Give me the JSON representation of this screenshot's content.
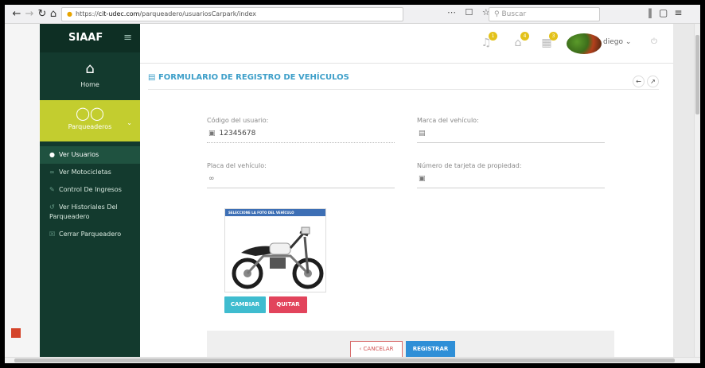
{
  "browser": {
    "url_prefix": "https://",
    "url_host": "cit-udec.com",
    "url_path": "/parqueadero/usuariosCarpark/index",
    "search_placeholder": "Buscar"
  },
  "sidebar": {
    "brand": "SIAAF",
    "home_label": "Home",
    "module_label": "Parqueaderos",
    "items": [
      {
        "label": "Ver Usuarios",
        "icon": "user-icon",
        "active": true
      },
      {
        "label": "Ver Motocicletas",
        "icon": "motorcycle-icon",
        "active": false
      },
      {
        "label": "Control De Ingresos",
        "icon": "edit-icon",
        "active": false
      },
      {
        "label": "Ver Historiales Del Parqueadero",
        "icon": "history-icon",
        "active": false
      },
      {
        "label": "Cerrar Parqueadero",
        "icon": "close-square-icon",
        "active": false
      }
    ]
  },
  "topbar": {
    "user_name": "diego",
    "notifications": [
      "1",
      "4",
      "3"
    ]
  },
  "form": {
    "title": "FORMULARIO DE REGISTRO DE VEHÍCULOS",
    "user_code_label": "Código del usuario:",
    "user_code_value": "12345678",
    "brand_label": "Marca del vehículo:",
    "brand_value": "",
    "plate_label": "Placa del vehículo:",
    "plate_value": "",
    "card_label": "Número de tarjeta de propiedad:",
    "card_value": "",
    "photo_header": "SELECCIONE LA FOTO DEL VEHÍCULO",
    "change_button": "CAMBIAR",
    "remove_button": "QUITAR",
    "cancel_button": "‹ CANCELAR",
    "register_button": "REGISTRAR"
  },
  "colors": {
    "sidebar_bg": "#133a2e",
    "accent_yellow": "#c3cd2f",
    "title_blue": "#3d9fc9",
    "register_blue": "#2f8fd7",
    "remove_red": "#e2445c",
    "change_cyan": "#3fbccf"
  }
}
